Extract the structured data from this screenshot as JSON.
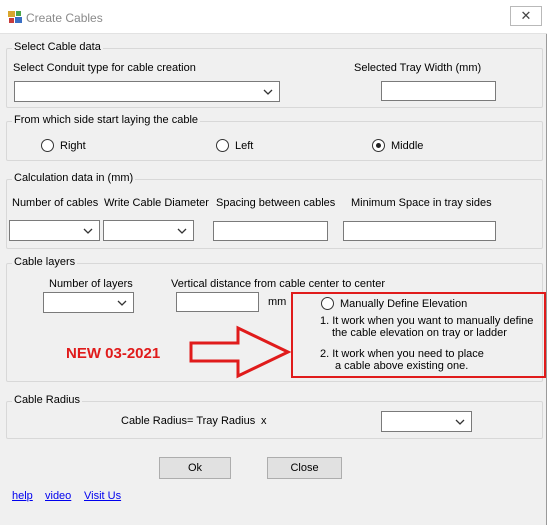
{
  "window": {
    "title": "Create Cables",
    "close_glyph": "✕"
  },
  "cable_data": {
    "group_label": "Select Cable data",
    "conduit_label": "Select Conduit type for cable creation",
    "conduit_value": "",
    "tray_width_label": "Selected Tray Width (mm)",
    "tray_width_value": ""
  },
  "laying_side": {
    "group_label": "From which side start laying the cable",
    "options": [
      {
        "label": "Right",
        "checked": false
      },
      {
        "label": "Left",
        "checked": false
      },
      {
        "label": "Middle",
        "checked": true
      }
    ]
  },
  "calculation": {
    "group_label": "Calculation data in (mm)",
    "num_cables_label": "Number of cables",
    "diameter_label": "Write Cable Diameter",
    "spacing_label": "Spacing between cables",
    "min_space_label": "Minimum Space in tray sides"
  },
  "layers": {
    "group_label": "Cable layers",
    "num_layers_label": "Number of layers",
    "vertical_distance_label": "Vertical distance from cable center to center",
    "unit": "mm",
    "manual_elevation_label": "Manually Define Elevation",
    "manual_elevation_checked": false,
    "note1_line1": "1. It work when you want to manually define",
    "note1_line2": "the cable elevation on tray or ladder",
    "note2_line1": "2. It work when you need to place",
    "note2_line2": "a cable above existing one."
  },
  "annotation": {
    "new_label": "NEW 03-2021",
    "highlight_color": "#e01b1b"
  },
  "radius": {
    "group_label": "Cable Radius",
    "formula_label": "Cable Radius= Tray Radius",
    "multiplier": "x"
  },
  "buttons": {
    "ok": "Ok",
    "close": "Close"
  },
  "links": {
    "help": "help",
    "video": "video",
    "visit": "Visit Us"
  }
}
